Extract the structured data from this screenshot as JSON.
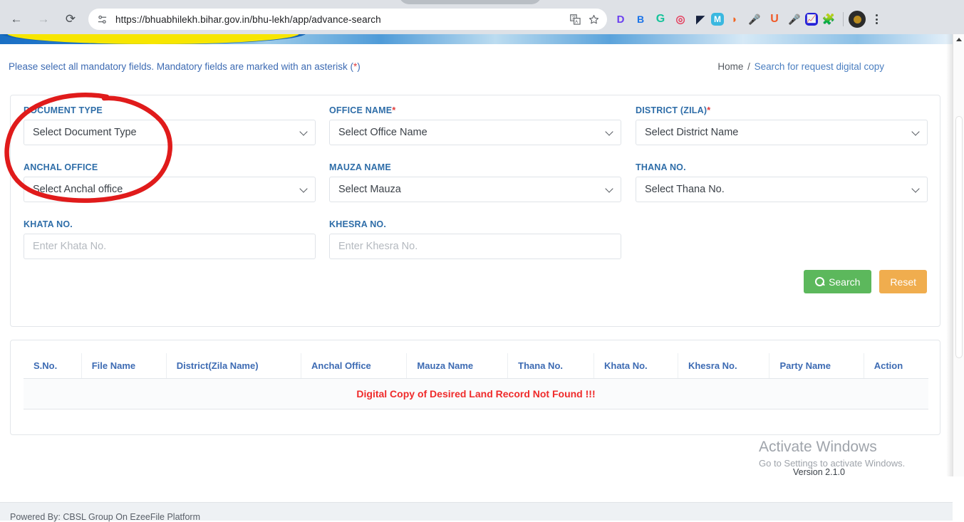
{
  "browser": {
    "url": "https://bhuabhilekh.bihar.gov.in/bhu-lekh/app/advance-search",
    "back_label": "←",
    "forward_label": "→",
    "reload_label": "⟳",
    "extensions": [
      {
        "name": "d-extension-icon",
        "glyph": "D",
        "color": "#6b3ff0",
        "bg": "#ffffff"
      },
      {
        "name": "grammar-extension-icon",
        "glyph": "B",
        "color": "#1a73e8",
        "bg": "#ffffff"
      },
      {
        "name": "grammarly-extension-icon",
        "glyph": "G",
        "color": "#15c39a",
        "bg": "#ffffff"
      },
      {
        "name": "instagram-extension-icon",
        "glyph": "◎",
        "color": "#e4405f",
        "bg": "#ffffff"
      },
      {
        "name": "dark-reader-extension-icon",
        "glyph": "◆",
        "color": "#16213e",
        "bg": "#ffffff"
      },
      {
        "name": "mega-extension-icon",
        "glyph": "M",
        "color": "#ffffff",
        "bg": "#3ab8e0"
      },
      {
        "name": "flame-extension-icon",
        "glyph": "◗",
        "color": "#f26522",
        "bg": "#ffffff"
      },
      {
        "name": "mic-red-extension-icon",
        "glyph": "🎤",
        "color": "#e03a3a",
        "bg": "#ffffff"
      },
      {
        "name": "u-extension-icon",
        "glyph": "U",
        "color": "#f05a28",
        "bg": "#ffffff"
      },
      {
        "name": "mic-gray-extension-icon",
        "glyph": "🎤",
        "color": "#808080",
        "bg": "#ffffff"
      },
      {
        "name": "analytics-extension-icon",
        "glyph": "📈",
        "color": "#ffffff",
        "bg": "#2622d8"
      },
      {
        "name": "puzzle-extensions-icon",
        "glyph": "🧩",
        "color": "#5f6368",
        "bg": "#ffffff"
      }
    ],
    "translate_icon": "translate-icon",
    "bookmark_icon": "star-icon",
    "profile_icon": "profile-avatar",
    "menu_icon": "three-dot-menu-icon"
  },
  "notice": {
    "text_before": "Please select all mandatory fields. Mandatory fields are marked with an asterisk (",
    "asterisk": "*",
    "text_after": ")"
  },
  "breadcrumb": {
    "home": "Home",
    "separator": "/",
    "current": "Search for request digital copy"
  },
  "form": {
    "fields": [
      {
        "name": "document-type",
        "label": "DOCUMENT TYPE",
        "required": false,
        "type": "select",
        "value": "Select Document Type"
      },
      {
        "name": "office-name",
        "label": "OFFICE NAME",
        "required": true,
        "type": "select",
        "value": "Select Office Name"
      },
      {
        "name": "district-zila",
        "label": "DISTRICT (ZILA)",
        "required": true,
        "type": "select",
        "value": "Select District Name"
      },
      {
        "name": "anchal-office",
        "label": "ANCHAL OFFICE",
        "required": false,
        "type": "select",
        "value": "Select Anchal office"
      },
      {
        "name": "mauza-name",
        "label": "MAUZA NAME",
        "required": false,
        "type": "select",
        "value": "Select Mauza"
      },
      {
        "name": "thana-no",
        "label": "THANA NO.",
        "required": false,
        "type": "select",
        "value": "Select Thana No."
      },
      {
        "name": "khata-no",
        "label": "KHATA NO.",
        "required": false,
        "type": "text",
        "value": "",
        "placeholder": "Enter Khata No."
      },
      {
        "name": "khesra-no",
        "label": "KHESRA NO.",
        "required": false,
        "type": "text",
        "value": "",
        "placeholder": "Enter Khesra No."
      }
    ],
    "required_marker": "*",
    "search_label": "Search",
    "reset_label": "Reset",
    "search_icon": "magnifier-icon",
    "search_color": "#5cb85c",
    "reset_color": "#f0ad4e"
  },
  "results": {
    "columns": [
      "S.No.",
      "File Name",
      "District(Zila Name)",
      "Anchal Office",
      "Mauza Name",
      "Thana No.",
      "Khata No.",
      "Khesra No.",
      "Party Name",
      "Action"
    ],
    "rows": [],
    "empty_message": "Digital Copy of Desired Land Record Not Found !!!",
    "empty_message_color": "#ef2b2b"
  },
  "footer": {
    "powered_by": "Powered By: CBSL Group On EzeeFile Platform",
    "version": "Version 2.1.0"
  },
  "watermark": {
    "title": "Activate Windows",
    "subtitle": "Go to Settings to activate Windows."
  },
  "annotation": {
    "name": "red-ellipse-annotation",
    "color": "#e01b1b"
  }
}
